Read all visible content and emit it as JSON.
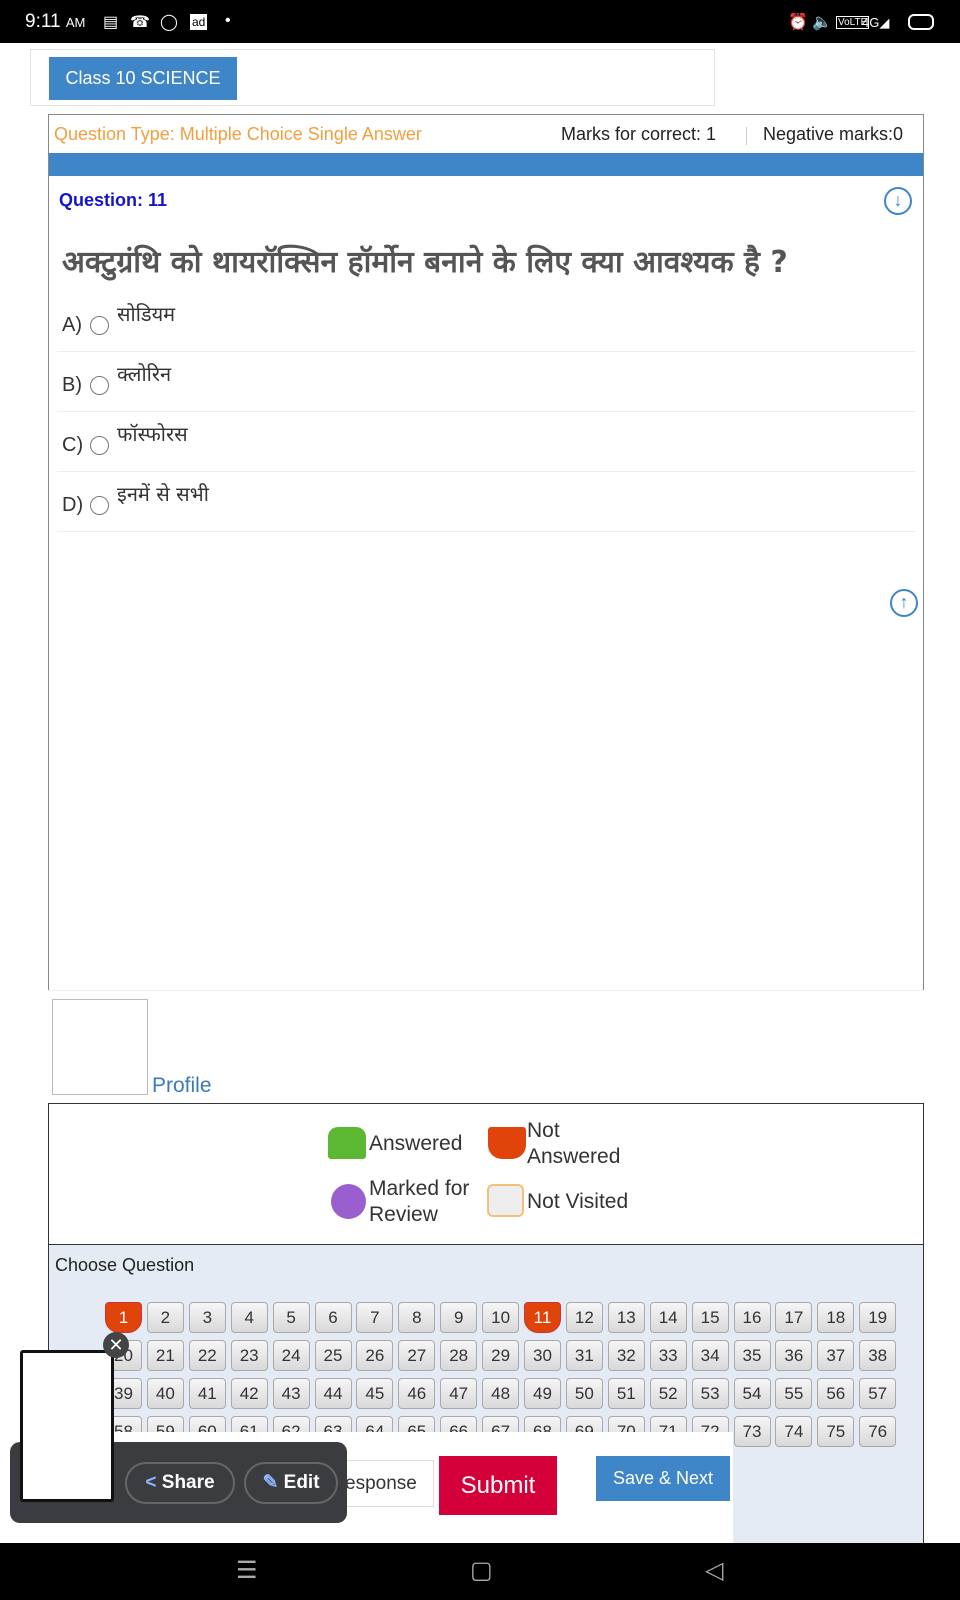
{
  "status": {
    "time": "9:11",
    "ampm": "AM",
    "icons": [
      "notes-icon",
      "missed-call-icon",
      "whatsapp-icon",
      "ad-icon",
      "dot-icon"
    ],
    "right_icons": [
      "alarm-icon",
      "mute-icon",
      "volte-icon",
      "4g-signal-icon",
      "battery-icon"
    ],
    "network": "4G"
  },
  "header": {
    "class_label": "Class 10 SCIENCE"
  },
  "question": {
    "type": "Question Type: Multiple Choice Single Answer",
    "marks_correct": "Marks for correct: 1",
    "negative": "Negative marks:0",
    "number": "Question: 11",
    "text": "अक्टुग्रंथि को थायरॉक्सिन हॉर्मोन बनाने के लिए क्या आवश्यक है ?",
    "options": [
      {
        "letter": "A)",
        "text": "सोडियम"
      },
      {
        "letter": "B)",
        "text": "क्लोरिन"
      },
      {
        "letter": "C)",
        "text": "फॉस्फोरस"
      },
      {
        "letter": "D)",
        "text": "इनमें से सभी"
      }
    ]
  },
  "profile": {
    "link": "Profile"
  },
  "legend": {
    "answered": "Answered",
    "not_answered_1": "Not",
    "not_answered_2": "Answered",
    "marked_1": "Marked for",
    "marked_2": "Review",
    "not_visited": "Not Visited",
    "colors": {
      "answered": "#5cb832",
      "not_answered": "#e0440a",
      "marked": "#9a5fcf",
      "not_visited": "#e8e8e8"
    }
  },
  "chooser": {
    "label": "Choose Question",
    "total": 76,
    "not_answered": [
      1,
      11
    ]
  },
  "buttons": {
    "clear": "esponse",
    "submit": "Submit",
    "save_next": "Save & Next"
  },
  "screenshot_popup": {
    "share": "Share",
    "edit": "Edit"
  },
  "navbar": {
    "menu": "☰",
    "home": "▢",
    "back": "◁"
  }
}
